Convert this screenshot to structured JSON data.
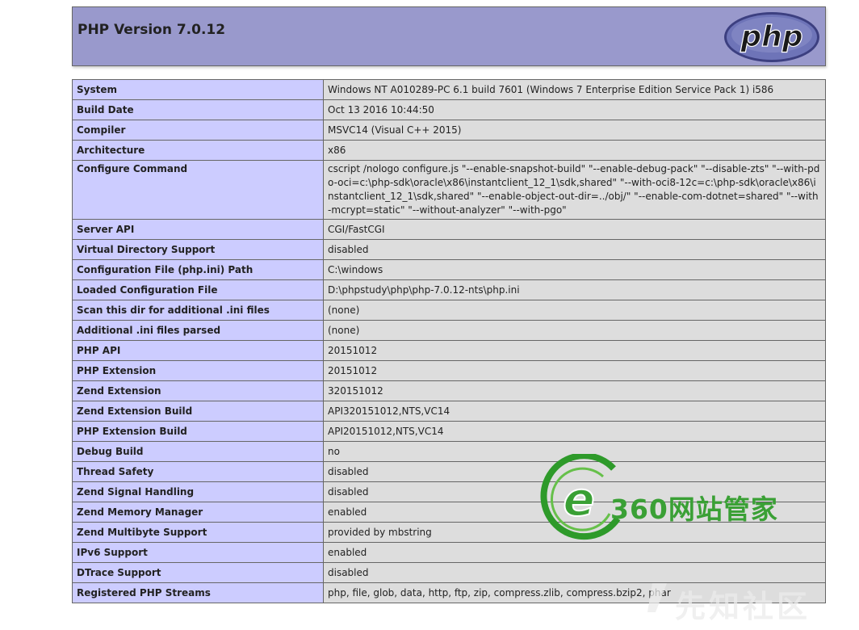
{
  "header": {
    "title": "PHP Version 7.0.12",
    "logo_text": "php"
  },
  "rows": [
    {
      "key": "System",
      "value": "Windows NT A010289-PC 6.1 build 7601 (Windows 7 Enterprise Edition Service Pack 1) i586"
    },
    {
      "key": "Build Date",
      "value": "Oct 13 2016 10:44:50"
    },
    {
      "key": "Compiler",
      "value": "MSVC14 (Visual C++ 2015)"
    },
    {
      "key": "Architecture",
      "value": "x86"
    },
    {
      "key": "Configure Command",
      "value": "cscript /nologo configure.js \"--enable-snapshot-build\" \"--enable-debug-pack\" \"--disable-zts\" \"--with-pdo-oci=c:\\php-sdk\\oracle\\x86\\instantclient_12_1\\sdk,shared\" \"--with-oci8-12c=c:\\php-sdk\\oracle\\x86\\instantclient_12_1\\sdk,shared\" \"--enable-object-out-dir=../obj/\" \"--enable-com-dotnet=shared\" \"--with-mcrypt=static\" \"--without-analyzer\" \"--with-pgo\""
    },
    {
      "key": "Server API",
      "value": "CGI/FastCGI"
    },
    {
      "key": "Virtual Directory Support",
      "value": "disabled"
    },
    {
      "key": "Configuration File (php.ini) Path",
      "value": "C:\\windows"
    },
    {
      "key": "Loaded Configuration File",
      "value": "D:\\phpstudy\\php\\php-7.0.12-nts\\php.ini"
    },
    {
      "key": "Scan this dir for additional .ini files",
      "value": "(none)"
    },
    {
      "key": "Additional .ini files parsed",
      "value": "(none)"
    },
    {
      "key": "PHP API",
      "value": "20151012"
    },
    {
      "key": "PHP Extension",
      "value": "20151012"
    },
    {
      "key": "Zend Extension",
      "value": "320151012"
    },
    {
      "key": "Zend Extension Build",
      "value": "API320151012,NTS,VC14"
    },
    {
      "key": "PHP Extension Build",
      "value": "API20151012,NTS,VC14"
    },
    {
      "key": "Debug Build",
      "value": "no"
    },
    {
      "key": "Thread Safety",
      "value": "disabled"
    },
    {
      "key": "Zend Signal Handling",
      "value": "disabled"
    },
    {
      "key": "Zend Memory Manager",
      "value": "enabled"
    },
    {
      "key": "Zend Multibyte Support",
      "value": "provided by mbstring"
    },
    {
      "key": "IPv6 Support",
      "value": "enabled"
    },
    {
      "key": "DTrace Support",
      "value": "disabled"
    },
    {
      "key": "Registered PHP Streams",
      "value": "php, file, glob, data, http, ftp, zip, compress.zlib, compress.bzip2, phar"
    }
  ],
  "watermarks": {
    "site_manager": "360网站管家",
    "xianzhi": "先知社区"
  }
}
